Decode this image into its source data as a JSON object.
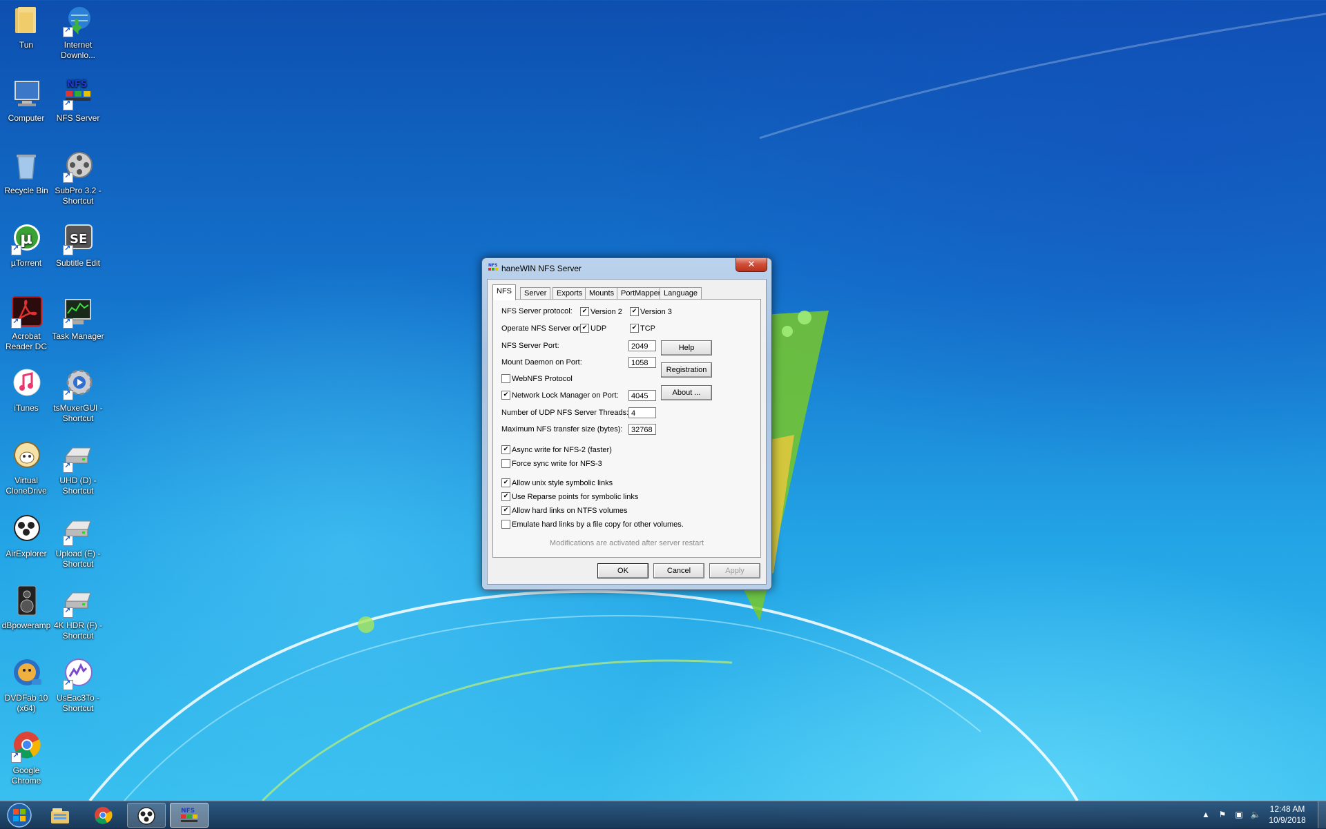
{
  "desktop_icons": [
    {
      "label": "Tun",
      "icon": "folder-icon"
    },
    {
      "label": "Internet Downlo...",
      "icon": "internet-download-manager-icon"
    },
    {
      "label": "Computer",
      "icon": "computer-icon"
    },
    {
      "label": "NFS Server",
      "icon": "nfs-server-icon"
    },
    {
      "label": "Recycle Bin",
      "icon": "recycle-bin-icon"
    },
    {
      "label": "SubPro 3.2 - Shortcut",
      "icon": "film-reel-icon"
    },
    {
      "label": "µTorrent",
      "icon": "utorrent-icon"
    },
    {
      "label": "Subtitle Edit",
      "icon": "subtitle-edit-icon"
    },
    {
      "label": "Acrobat Reader DC",
      "icon": "acrobat-icon"
    },
    {
      "label": "Task Manager",
      "icon": "task-manager-icon"
    },
    {
      "label": "iTunes",
      "icon": "itunes-icon"
    },
    {
      "label": "tsMuxerGUI - Shortcut",
      "icon": "gear-icon"
    },
    {
      "label": "Virtual CloneDrive",
      "icon": "sheep-icon"
    },
    {
      "label": "UHD (D) - Shortcut",
      "icon": "drive-icon"
    },
    {
      "label": "AirExplorer",
      "icon": "cloud-icon"
    },
    {
      "label": "Upload (E) - Shortcut",
      "icon": "drive-icon"
    },
    {
      "label": "dBpoweramp",
      "icon": "speaker-icon"
    },
    {
      "label": "4K HDR (F) - Shortcut",
      "icon": "drive-icon"
    },
    {
      "label": "DVDFab 10 (x64)",
      "icon": "dvdfab-icon"
    },
    {
      "label": "UsEac3To - Shortcut",
      "icon": "usEac3to-icon"
    },
    {
      "label": "Google Chrome",
      "icon": "chrome-icon"
    }
  ],
  "dialog": {
    "title": "haneWIN NFS Server",
    "close_label": "✕",
    "tabs": [
      "NFS",
      "Server",
      "Exports",
      "Mounts",
      "PortMapper",
      "Language"
    ],
    "nfs_protocol_label": "NFS Server protocol:",
    "version2_label": "Version 2",
    "version3_label": "Version 3",
    "operate_on_label": "Operate NFS Server on:",
    "udp_label": "UDP",
    "tcp_label": "TCP",
    "nfs_port_label": "NFS Server Port:",
    "nfs_port_value": "2049",
    "mount_port_label": "Mount Daemon on Port:",
    "mount_port_value": "1058",
    "webnfs_label": "WebNFS Protocol",
    "nlm_label": "Network Lock Manager on Port:",
    "nlm_port_value": "4045",
    "udp_threads_label": "Number of UDP NFS Server Threads:",
    "udp_threads_value": "4",
    "max_transfer_label": "Maximum NFS transfer size (bytes):",
    "max_transfer_value": "32768",
    "async_label": "Async write for NFS-2 (faster)",
    "force_sync_label": "Force sync write for NFS-3",
    "unix_links_label": "Allow unix style symbolic links",
    "reparse_label": "Use Reparse points for symbolic links",
    "hard_links_label": "Allow hard links on NTFS volumes",
    "emulate_links_label": "Emulate hard links by a file copy for other volumes.",
    "note": "Modifications are activated after server restart",
    "help_label": "Help",
    "registration_label": "Registration",
    "about_label": "About ...",
    "ok_label": "OK",
    "cancel_label": "Cancel",
    "apply_label": "Apply",
    "checks": {
      "version2": true,
      "version3": true,
      "udp": true,
      "tcp": true,
      "webnfs": false,
      "nlm": true,
      "async": true,
      "force_sync": false,
      "unix_links": true,
      "reparse": true,
      "hard_links": true,
      "emulate_links": false
    }
  },
  "taskbar": {
    "time": "12:48 AM",
    "date": "10/9/2018",
    "items": [
      "windows-explorer-icon",
      "chrome-icon",
      "airexplorer-icon",
      "nfs-server-icon"
    ]
  }
}
